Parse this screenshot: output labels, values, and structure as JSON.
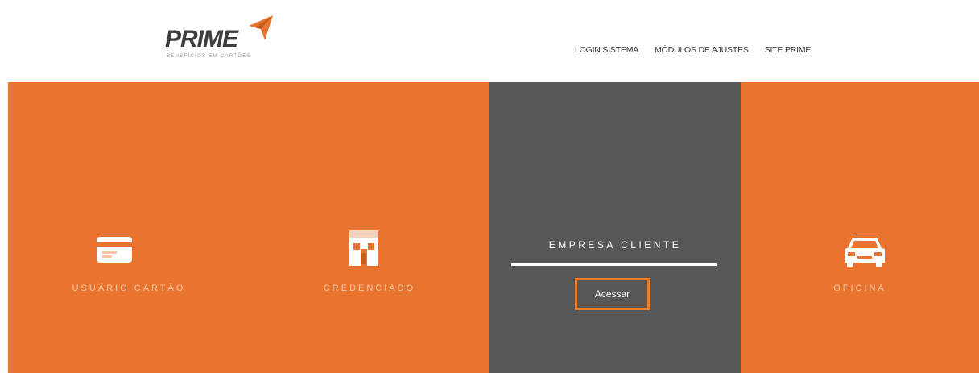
{
  "brand": {
    "name": "PRIME",
    "tagline": "BENEFÍCIOS EM CARTÕES",
    "accent_color": "#e87430",
    "dark_color": "#575757"
  },
  "nav": {
    "items": [
      {
        "label": "LOGIN SISTEMA"
      },
      {
        "label": "MÓDULOS DE AJUSTES"
      },
      {
        "label": "SITE PRIME"
      }
    ]
  },
  "panels": [
    {
      "label": "USUÁRIO CARTÃO",
      "icon": "credit-card-icon"
    },
    {
      "label": "CREDENCIADO",
      "icon": "storefront-icon"
    },
    {
      "label": "EMPRESA CLIENTE",
      "button": "Acessar"
    },
    {
      "label": "OFICINA",
      "icon": "car-icon"
    }
  ]
}
